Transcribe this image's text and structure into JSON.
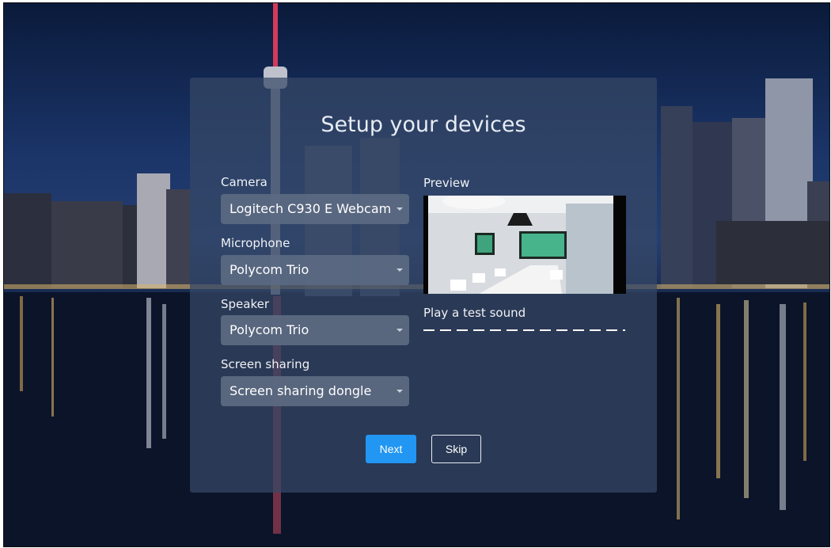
{
  "dialog": {
    "title": "Setup your devices",
    "camera": {
      "label": "Camera",
      "value": "Logitech C930 E Webcam"
    },
    "microphone": {
      "label": "Microphone",
      "value": "Polycom Trio"
    },
    "speaker": {
      "label": "Speaker",
      "value": "Polycom Trio"
    },
    "screen_sharing": {
      "label": "Screen sharing",
      "value": "Screen sharing dongle"
    },
    "preview": {
      "label": "Preview"
    },
    "test_sound": {
      "label": "Play a test sound"
    },
    "buttons": {
      "next": "Next",
      "skip": "Skip"
    }
  },
  "colors": {
    "primary_button": "#2196f3",
    "panel": "#364866",
    "select": "#5c6a82"
  }
}
